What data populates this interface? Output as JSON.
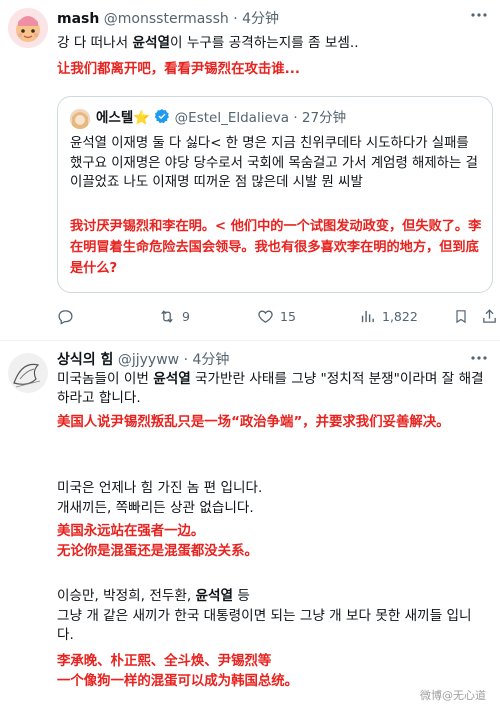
{
  "tweet1": {
    "name": "mash",
    "handle": "@monsstermassh",
    "sep": "·",
    "time": "4分钟",
    "text_a": "강 다 떠나서 ",
    "text_bold": "윤석열",
    "text_b": "이 누구를 공격하는지를 좀 보셈..",
    "translation": "让我们都离开吧，看看尹锡烈在攻击谁..."
  },
  "quote": {
    "name": "에스텔",
    "badge_emoji": "⭐",
    "handle": "@Estel_Eldalieva",
    "sep": "·",
    "time": "27分钟",
    "text": "윤석열 이재명 둘 다 싫다< 한 명은 지금 친위쿠데타 시도하다가 실패를 했구요 이재명은 야당 당수로서 국회에 목숨걸고 가서 계엄령 해제하는 걸 이끌었죠 나도 이재명 띠꺼운 점 많은데 시발 뭔 씨발",
    "translation": "我讨厌尹锡烈和李在明。< 他们中的一个试图发动政变，但失败了。李在明冒着生命危险去国会领导。我也有很多喜欢李在明的地方，但到底是什么?"
  },
  "actions": {
    "retweets": "9",
    "likes": "15",
    "views": "1,822"
  },
  "tweet2": {
    "name": "상식의 힘",
    "handle": "@jjyyww",
    "sep": "·",
    "time": "4分钟",
    "p1_a": "미국놈들이 이번 ",
    "p1_bold": "윤석열",
    "p1_b": " 국가반란 사태를 그냥 \"정치적 분쟁\"이라며 잘 해결 하라고 합니다.",
    "p1_translation": "美国人说尹锡烈叛乱只是一场“政治争端”，并要求我们妥善解决。",
    "p2_line1": "미국은 언제나 힘 가진 놈 편 입니다.",
    "p2_line2": "개새끼든, 쪽빠리든 상관 없습니다.",
    "p2_translation_1": "美国永远站在强者一边。",
    "p2_translation_2": "无论你是混蛋还是混蛋都没关系。",
    "p3_a": "이승만, 박정희, 전두환, ",
    "p3_bold": "윤석열",
    "p3_b": " 등",
    "p3_line2": "그냥 개 같은 새끼가 한국 대통령이면 되는 그냥 개 보다 못한 새끼들 입니다.",
    "p3_translation_1": "李承晚、朴正熙、全斗焕、尹锡烈等",
    "p3_translation_2": "一个像狗一样的混蛋可以成为韩国总统。"
  },
  "watermark": "微博@无心道",
  "colors": {
    "accent_red": "#e8231f",
    "verified_blue": "#1d9bf0",
    "muted": "#536471",
    "border": "#cfd9de"
  },
  "icons": {
    "more": "more-dots-icon",
    "retweet": "retweet-icon",
    "like": "heart-icon",
    "views": "views-chart-icon",
    "bookmark": "bookmark-icon",
    "share": "share-icon",
    "verified": "verified-badge-icon"
  }
}
